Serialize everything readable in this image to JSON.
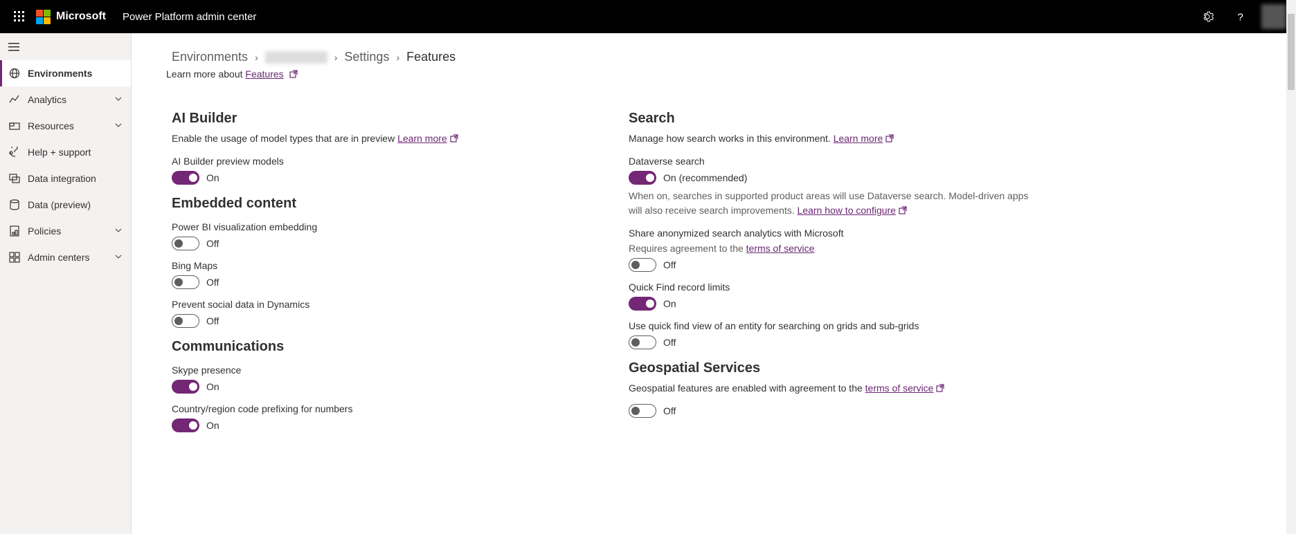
{
  "header": {
    "brand": "Microsoft",
    "app_title": "Power Platform admin center"
  },
  "sidebar": {
    "items": [
      {
        "label": "Environments",
        "selected": true,
        "expandable": false,
        "icon": "globe"
      },
      {
        "label": "Analytics",
        "selected": false,
        "expandable": true,
        "icon": "analytics"
      },
      {
        "label": "Resources",
        "selected": false,
        "expandable": true,
        "icon": "resources"
      },
      {
        "label": "Help + support",
        "selected": false,
        "expandable": false,
        "icon": "help"
      },
      {
        "label": "Data integration",
        "selected": false,
        "expandable": false,
        "icon": "data-int"
      },
      {
        "label": "Data (preview)",
        "selected": false,
        "expandable": false,
        "icon": "data"
      },
      {
        "label": "Policies",
        "selected": false,
        "expandable": true,
        "icon": "policies"
      },
      {
        "label": "Admin centers",
        "selected": false,
        "expandable": true,
        "icon": "admin"
      }
    ]
  },
  "breadcrumb": {
    "items": [
      "Environments",
      "",
      "Settings",
      "Features"
    ],
    "current": "Features"
  },
  "learn_more_line": {
    "prefix": "Learn more about ",
    "link": "Features"
  },
  "left_column": {
    "sections": [
      {
        "title": "AI Builder",
        "desc": "Enable the usage of model types that are in preview ",
        "desc_link": "Learn more",
        "settings": [
          {
            "label": "AI Builder preview models",
            "value": true,
            "on_text": "On",
            "off_text": "Off"
          }
        ]
      },
      {
        "title": "Embedded content",
        "desc": "",
        "settings": [
          {
            "label": "Power BI visualization embedding",
            "value": false,
            "on_text": "On",
            "off_text": "Off"
          },
          {
            "label": "Bing Maps",
            "value": false,
            "on_text": "On",
            "off_text": "Off"
          },
          {
            "label": "Prevent social data in Dynamics",
            "value": false,
            "on_text": "On",
            "off_text": "Off"
          }
        ]
      },
      {
        "title": "Communications",
        "desc": "",
        "settings": [
          {
            "label": "Skype presence",
            "value": true,
            "on_text": "On",
            "off_text": "Off"
          },
          {
            "label": "Country/region code prefixing for numbers",
            "value": true,
            "on_text": "On",
            "off_text": "Off"
          }
        ]
      }
    ]
  },
  "right_column": {
    "sections": [
      {
        "title": "Search",
        "desc": "Manage how search works in this environment. ",
        "desc_link": "Learn more",
        "settings": [
          {
            "label": "Dataverse search",
            "value": true,
            "on_text": "On (recommended)",
            "off_text": "Off",
            "help": "When on, searches in supported product areas will use Dataverse search. Model-driven apps will also receive search improvements. ",
            "help_link": "Learn how to configure"
          },
          {
            "label": "Share anonymized search analytics with Microsoft",
            "sub": "Requires agreement to the ",
            "sub_link": "terms of service",
            "value": false,
            "on_text": "On",
            "off_text": "Off"
          },
          {
            "label": "Quick Find record limits",
            "value": true,
            "on_text": "On",
            "off_text": "Off"
          },
          {
            "label": "Use quick find view of an entity for searching on grids and sub-grids",
            "value": false,
            "on_text": "On",
            "off_text": "Off"
          }
        ]
      },
      {
        "title": "Geospatial Services",
        "desc": "Geospatial features are enabled with agreement to the ",
        "desc_link": "terms of service",
        "settings": [
          {
            "label": "",
            "value": false,
            "on_text": "On",
            "off_text": "Off"
          }
        ]
      }
    ]
  }
}
